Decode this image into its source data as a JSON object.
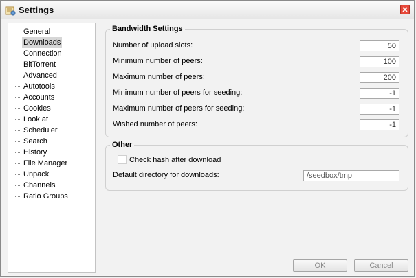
{
  "window": {
    "title": "Settings"
  },
  "sidebar": {
    "items": [
      {
        "label": "General"
      },
      {
        "label": "Downloads",
        "selected": true
      },
      {
        "label": "Connection"
      },
      {
        "label": "BitTorrent"
      },
      {
        "label": "Advanced"
      },
      {
        "label": "Autotools"
      },
      {
        "label": "Accounts"
      },
      {
        "label": "Cookies"
      },
      {
        "label": "Look at"
      },
      {
        "label": "Scheduler"
      },
      {
        "label": "Search"
      },
      {
        "label": "History"
      },
      {
        "label": "File Manager"
      },
      {
        "label": "Unpack"
      },
      {
        "label": "Channels"
      },
      {
        "label": "Ratio Groups"
      }
    ]
  },
  "bandwidth": {
    "title": "Bandwidth Settings",
    "fields": [
      {
        "label": "Number of upload slots:",
        "value": "50"
      },
      {
        "label": "Minimum number of peers:",
        "value": "100"
      },
      {
        "label": "Maximum number of peers:",
        "value": "200"
      },
      {
        "label": "Minimum number of peers for seeding:",
        "value": "-1"
      },
      {
        "label": "Maximum number of peers for seeding:",
        "value": "-1"
      },
      {
        "label": "Wished number of peers:",
        "value": "-1"
      }
    ]
  },
  "other": {
    "title": "Other",
    "check_hash_label": "Check hash after download",
    "check_hash_checked": false,
    "default_dir_label": "Default directory for downloads:",
    "default_dir_value": "/seedbox/tmp"
  },
  "buttons": {
    "ok": "OK",
    "cancel": "Cancel"
  },
  "colors": {
    "close_button": "#e8483a",
    "selected_bg": "#d6d6d6",
    "disabled_text": "#8a8a8a"
  }
}
